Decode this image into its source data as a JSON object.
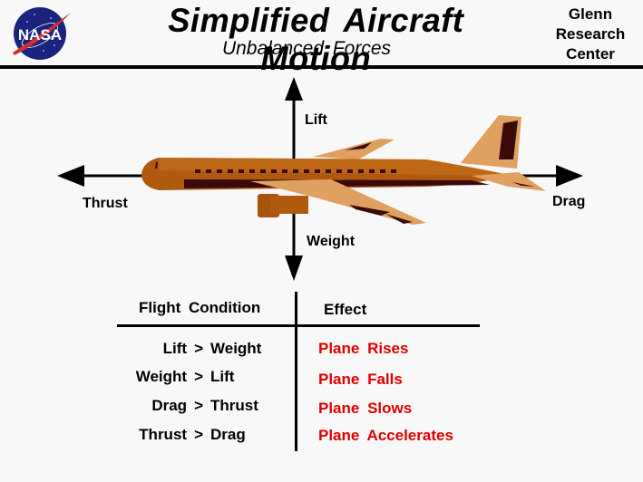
{
  "header": {
    "logo": "nasa-logo",
    "logo_text": "NASA",
    "title": "Simplified  Aircraft  Motion",
    "subtitle": "Unbalanced  Forces",
    "center": [
      "Glenn",
      "Research",
      "Center"
    ]
  },
  "diagram": {
    "forces": {
      "lift": "Lift",
      "weight": "Weight",
      "thrust": "Thrust",
      "drag": "Drag"
    },
    "aircraft_colors": {
      "body": "#b05a10",
      "wing": "#e0a060",
      "stripe": "#3a0a0a"
    }
  },
  "table": {
    "headers": {
      "condition": "Flight  Condition",
      "effect": "Effect"
    },
    "rows": [
      {
        "left": "Lift",
        "op": ">",
        "right": "Weight",
        "effect": "Plane  Rises"
      },
      {
        "left": "Weight",
        "op": ">",
        "right": "Lift",
        "effect": "Plane  Falls"
      },
      {
        "left": "Drag",
        "op": ">",
        "right": "Thrust",
        "effect": "Plane  Slows"
      },
      {
        "left": "Thrust",
        "op": ">",
        "right": "Drag",
        "effect": "Plane  Accelerates"
      }
    ],
    "effect_color": "#e00000"
  }
}
